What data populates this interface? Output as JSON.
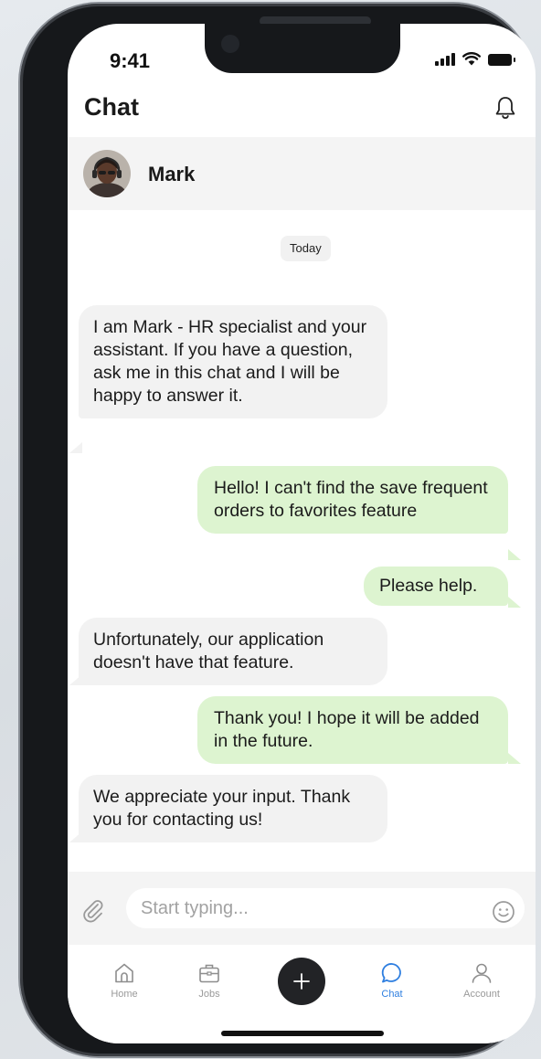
{
  "status_bar": {
    "time": "9:41"
  },
  "header": {
    "title": "Chat"
  },
  "contact": {
    "name": "Mark"
  },
  "chat": {
    "date_label": "Today",
    "messages": [
      {
        "direction": "in",
        "text": "I am Mark - HR specialist and your assistant. If you have a question, ask me in this chat and I will be happy to answer it."
      },
      {
        "direction": "out",
        "text": "Hello! I can't find the save frequent orders to favorites feature"
      },
      {
        "direction": "out",
        "text": "Please help."
      },
      {
        "direction": "in",
        "text": "Unfortunately, our application doesn't have that feature."
      },
      {
        "direction": "out",
        "text": "Thank you! I hope it will be added in the future."
      },
      {
        "direction": "in",
        "text": "We appreciate your input. Thank you for contacting us!"
      }
    ]
  },
  "composer": {
    "placeholder": "Start typing..."
  },
  "tabbar": {
    "items": [
      {
        "label": "Home",
        "icon": "home-icon"
      },
      {
        "label": "Jobs",
        "icon": "briefcase-icon"
      },
      {
        "label": "Chat",
        "icon": "chat-bubble-icon",
        "active": true
      },
      {
        "label": "Account",
        "icon": "user-icon"
      }
    ],
    "fab_icon": "plus-icon"
  },
  "colors": {
    "incoming_bubble": "#f2f2f2",
    "outgoing_bubble": "#ddf4d0",
    "accent": "#2f7fe0",
    "fab": "#222326"
  }
}
